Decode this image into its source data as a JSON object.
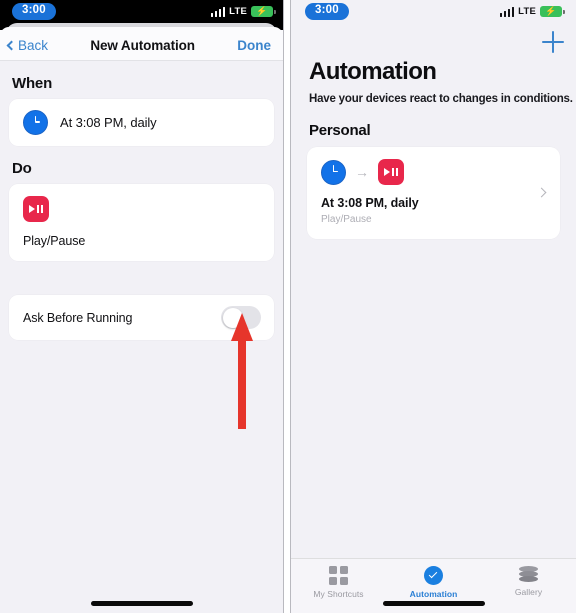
{
  "left_screen": {
    "status_bar": {
      "time": "3:00",
      "network": "LTE",
      "signal_icon": "signal-bars-icon",
      "battery_icon": "battery-charging-icon"
    },
    "nav": {
      "back_label": "Back",
      "title": "New Automation",
      "done_label": "Done"
    },
    "when_section": {
      "heading": "When",
      "trigger_icon": "clock-icon",
      "trigger_text": "At 3:08 PM, daily"
    },
    "do_section": {
      "heading": "Do",
      "action_icon": "play-pause-icon",
      "action_label": "Play/Pause"
    },
    "ask_before_running": {
      "label": "Ask Before Running",
      "state": "off"
    },
    "annotation": {
      "type": "arrow-up",
      "color": "#e6352b",
      "points_at": "ask-before-running-toggle"
    }
  },
  "right_screen": {
    "status_bar": {
      "time": "3:00",
      "network": "LTE",
      "signal_icon": "signal-bars-icon",
      "battery_icon": "battery-charging-icon"
    },
    "add_button_icon": "plus-icon",
    "title": "Automation",
    "subtitle": "Have your devices react to changes in conditions.",
    "group_title": "Personal",
    "automation_card": {
      "trigger_icon": "clock-icon",
      "arrow_glyph": "→",
      "action_icon": "play-pause-icon",
      "title": "At 3:08 PM, daily",
      "subtitle": "Play/Pause",
      "chevron_icon": "chevron-right-icon"
    },
    "tab_bar": {
      "tabs": [
        {
          "label": "My Shortcuts",
          "icon": "grid-icon",
          "active": false
        },
        {
          "label": "Automation",
          "icon": "automation-check-icon",
          "active": true
        },
        {
          "label": "Gallery",
          "icon": "gallery-layers-icon",
          "active": false
        }
      ]
    }
  },
  "colors": {
    "accent_blue": "#3b84cc",
    "tab_active": "#2a7fd4",
    "action_red": "#e8274b",
    "annotation_red": "#e6352b",
    "background": "#f2f1f6"
  }
}
